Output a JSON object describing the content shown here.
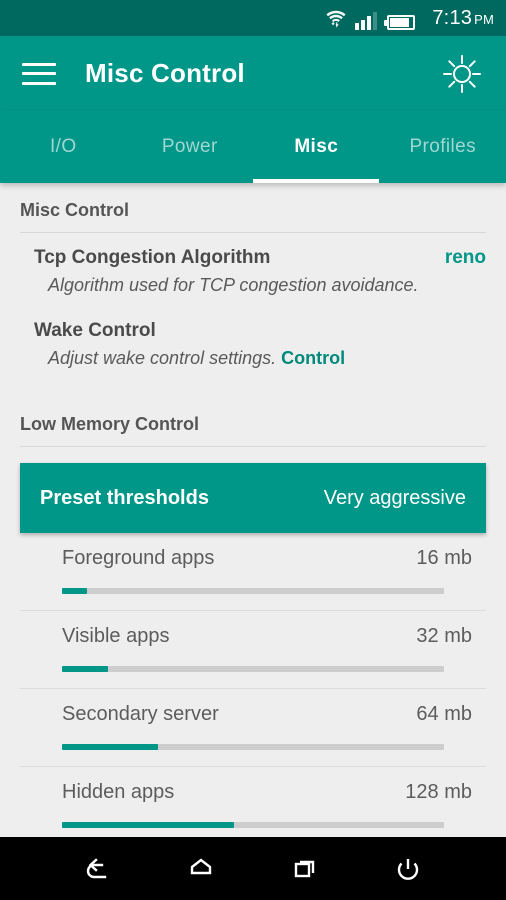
{
  "statusbar": {
    "time": "7:13",
    "ampm": "PM",
    "wifi_icon": "wifi-icon",
    "signal_icon": "signal-bars-icon",
    "battery_icon": "battery-icon"
  },
  "appbar": {
    "menu_icon": "hamburger-menu-icon",
    "title": "Misc Control",
    "action_icon": "brightness-sun-icon"
  },
  "tabs": [
    {
      "label": "I/O",
      "active": false
    },
    {
      "label": "Power",
      "active": false
    },
    {
      "label": "Misc",
      "active": true
    },
    {
      "label": "Profiles",
      "active": false
    }
  ],
  "sections": [
    {
      "header": "Misc Control",
      "prefs": [
        {
          "title": "Tcp Congestion Algorithm",
          "value": "reno",
          "summary": "Algorithm used for TCP congestion avoidance.",
          "link": ""
        },
        {
          "title": "Wake Control",
          "value": "",
          "summary": "Adjust wake control settings.",
          "link": "Control"
        }
      ]
    },
    {
      "header": "Low Memory Control"
    }
  ],
  "preset_card": {
    "title": "Preset thresholds",
    "value": "Very aggressive"
  },
  "sliders": [
    {
      "label": "Foreground apps",
      "value": "16 mb",
      "percent": 6.5
    },
    {
      "label": "Visible apps",
      "value": "32 mb",
      "percent": 12
    },
    {
      "label": "Secondary server",
      "value": "64 mb",
      "percent": 25
    },
    {
      "label": "Hidden apps",
      "value": "128 mb",
      "percent": 45
    }
  ],
  "navbar": [
    {
      "name": "back-button"
    },
    {
      "name": "home-button"
    },
    {
      "name": "recents-button"
    },
    {
      "name": "power-button"
    }
  ],
  "colors": {
    "accent": "#009688",
    "statusbar": "#00695f",
    "background": "#eeeeee"
  }
}
